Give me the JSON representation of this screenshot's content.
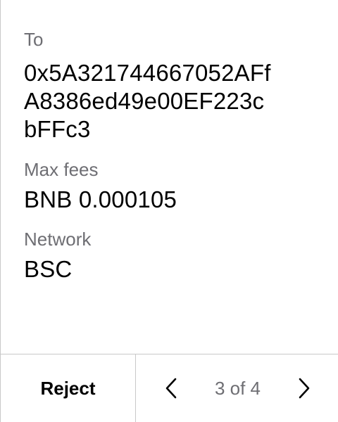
{
  "details": {
    "to_label": "To",
    "to_address_lines": [
      "0x5A321744667052AFf",
      "A8386ed49e00EF223c",
      "bFFc3"
    ],
    "max_fees_label": "Max fees",
    "max_fees_value": "BNB 0.000105",
    "network_label": "Network",
    "network_value": "BSC"
  },
  "footer": {
    "reject_label": "Reject",
    "pager_text": "3 of 4",
    "prev_icon": "chevron-left-icon",
    "next_icon": "chevron-right-icon"
  },
  "colors": {
    "label_gray": "#6e6e73",
    "divider": "#c8c8c8",
    "text": "#000000"
  }
}
